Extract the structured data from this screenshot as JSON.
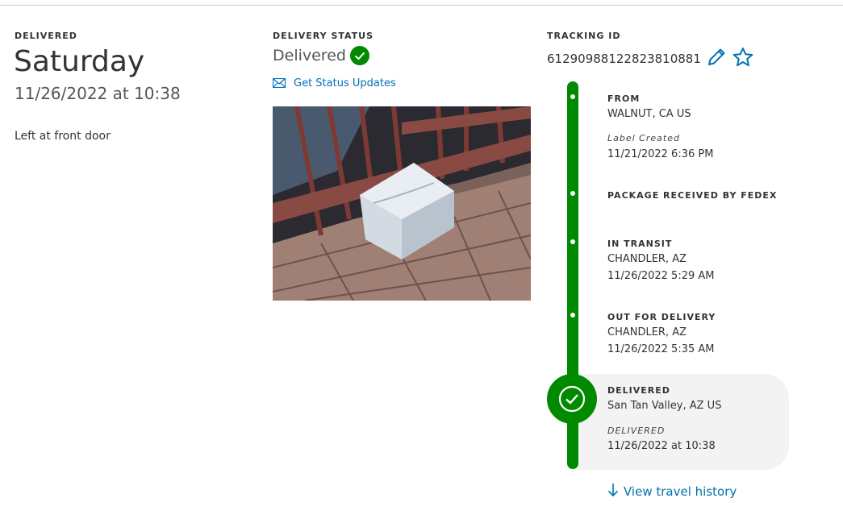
{
  "delivered_section": {
    "label": "DELIVERED",
    "day": "Saturday",
    "datetime": "11/26/2022 at 10:38",
    "note": "Left at front door"
  },
  "status_section": {
    "label": "DELIVERY STATUS",
    "status": "Delivered",
    "updates_link": "Get Status Updates"
  },
  "tracking_section": {
    "label": "TRACKING ID",
    "id": "612909881228238108​81"
  },
  "timeline": [
    {
      "heading": "FROM",
      "location": "WALNUT, CA US",
      "sublabel": "Label Created",
      "time": "11/21/2022 6:36 PM"
    },
    {
      "heading": "PACKAGE RECEIVED BY FEDEX"
    },
    {
      "heading": "IN TRANSIT",
      "location": "CHANDLER, AZ",
      "time": "11/26/2022 5:29 AM"
    },
    {
      "heading": "OUT FOR DELIVERY",
      "location": "CHANDLER, AZ",
      "time": "11/26/2022 5:35 AM"
    },
    {
      "heading": "DELIVERED",
      "location": "San Tan Valley, AZ US",
      "sublabel": "DELIVERED",
      "time": "11/26/2022 at 10:38"
    }
  ],
  "view_history": "View travel history",
  "colors": {
    "green": "#008a00",
    "link_blue": "#0072b2",
    "card_bg": "#f3f3f3"
  }
}
